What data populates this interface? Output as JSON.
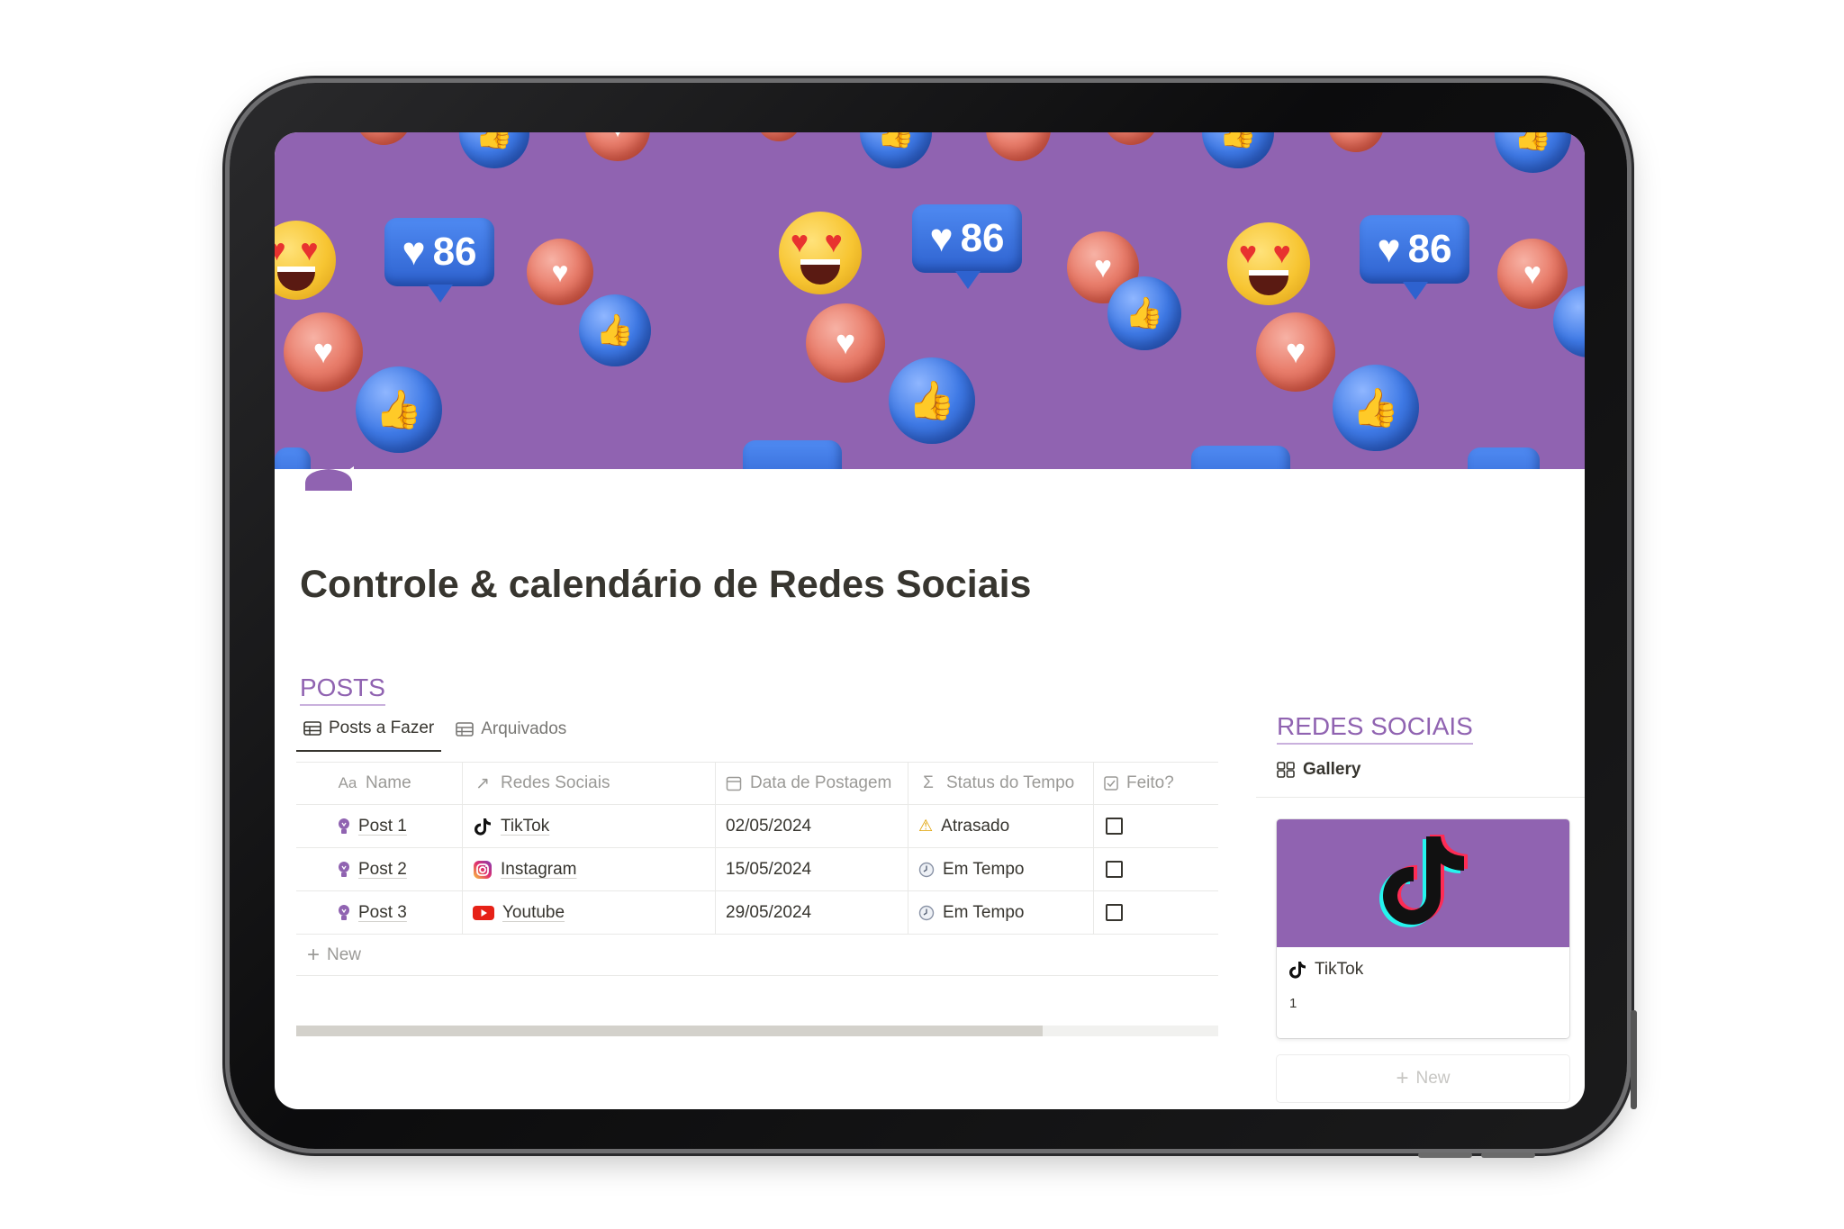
{
  "page": {
    "title": "Controle & calendário de Redes Sociais",
    "cover_color": "#9063b1",
    "accent_color": "#9063b1",
    "cover_badge_count": "86"
  },
  "posts_db": {
    "title": "POSTS",
    "views": [
      {
        "label": "Posts a Fazer",
        "icon": "table-icon",
        "active": true
      },
      {
        "label": "Arquivados",
        "icon": "table-icon",
        "active": false
      }
    ],
    "columns": [
      {
        "label": "Name",
        "icon": "Aa"
      },
      {
        "label": "Redes Sociais",
        "icon": "relation-arrow-icon"
      },
      {
        "label": "Data de Postagem",
        "icon": "calendar-icon"
      },
      {
        "label": "Status do Tempo",
        "icon": "formula-sigma-icon"
      },
      {
        "label": "Feito?",
        "icon": "checkbox-icon"
      }
    ],
    "rows": [
      {
        "name": "Post 1",
        "network": "TikTok",
        "network_icon": "tiktok-icon",
        "date": "02/05/2024",
        "status": "Atrasado",
        "status_icon": "warning-icon",
        "done": false
      },
      {
        "name": "Post 2",
        "network": "Instagram",
        "network_icon": "instagram-icon",
        "date": "15/05/2024",
        "status": "Em Tempo",
        "status_icon": "clock-icon",
        "done": false
      },
      {
        "name": "Post 3",
        "network": "Youtube",
        "network_icon": "youtube-icon",
        "date": "29/05/2024",
        "status": "Em Tempo",
        "status_icon": "clock-icon",
        "done": false
      }
    ],
    "new_label": "New",
    "scroll_position": 0.81
  },
  "redes_db": {
    "title": "REDES SOCIAIS",
    "view_label": "Gallery",
    "cards": [
      {
        "title": "TikTok",
        "count": "1"
      }
    ],
    "new_label": "New"
  }
}
